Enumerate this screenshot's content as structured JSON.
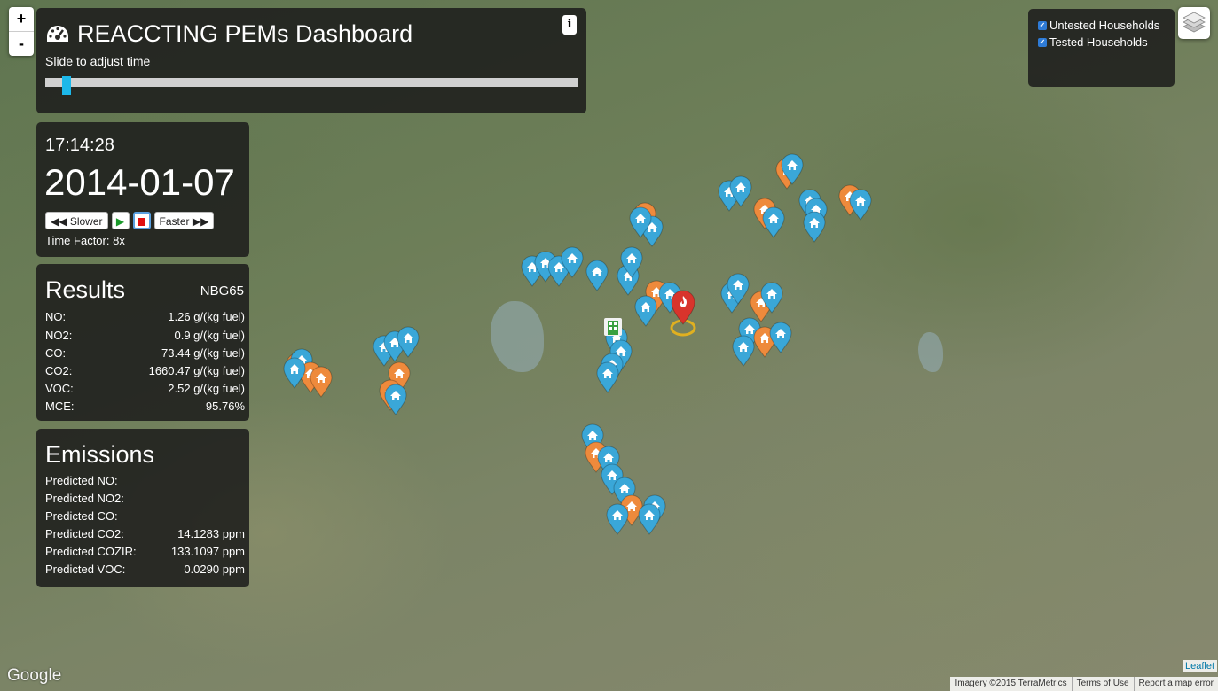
{
  "header": {
    "title": "REACCTING PEMs Dashboard",
    "slide_label": "Slide to adjust time",
    "info_label": "i"
  },
  "zoom": {
    "in": "+",
    "out": "-"
  },
  "playback": {
    "time": "17:14:28",
    "date": "2014-01-07",
    "slower_label": "Slower",
    "faster_label": "Faster",
    "time_factor": "Time Factor: 8x",
    "slider_position_fraction": 0.04
  },
  "results": {
    "title": "Results",
    "device": "NBG65",
    "rows": [
      {
        "label": "NO:",
        "value": "1.26 g/(kg fuel)"
      },
      {
        "label": "NO2:",
        "value": "0.9 g/(kg fuel)"
      },
      {
        "label": "CO:",
        "value": "73.44 g/(kg fuel)"
      },
      {
        "label": "CO2:",
        "value": "1660.47 g/(kg fuel)"
      },
      {
        "label": "VOC:",
        "value": "2.52 g/(kg fuel)"
      },
      {
        "label": "MCE:",
        "value": "95.76%"
      }
    ]
  },
  "emissions": {
    "title": "Emissions",
    "rows": [
      {
        "label": "Predicted NO:",
        "value": ""
      },
      {
        "label": "Predicted NO2:",
        "value": ""
      },
      {
        "label": "Predicted CO:",
        "value": ""
      },
      {
        "label": "Predicted CO2:",
        "value": "14.1283 ppm"
      },
      {
        "label": "Predicted COZIR:",
        "value": "133.1097 ppm"
      },
      {
        "label": "Predicted VOC:",
        "value": "0.0290 ppm"
      }
    ]
  },
  "layers": {
    "items": [
      {
        "label": "Untested Households",
        "checked": true
      },
      {
        "label": "Tested Households",
        "checked": true
      }
    ]
  },
  "map": {
    "google_label": "Google",
    "leaflet_label": "Leaflet",
    "attribution": [
      "Imagery ©2015 TerraMetrics",
      "Terms of Use",
      "Report a map error"
    ],
    "colors": {
      "untested": "#3aa7d8",
      "tested": "#ee8a3c",
      "active": "#d8342c",
      "slider": "#1cb8ea"
    }
  }
}
